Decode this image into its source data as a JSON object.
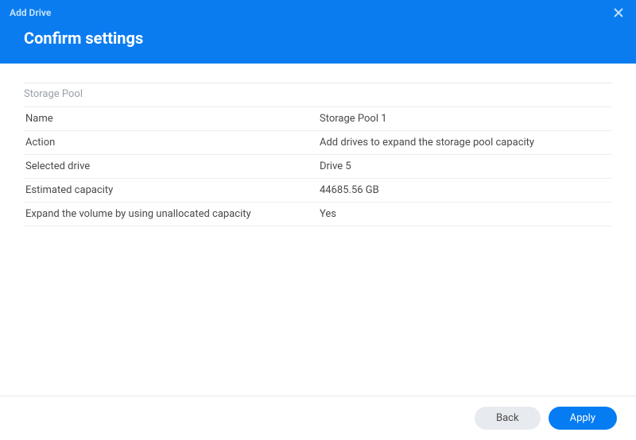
{
  "window": {
    "title": "Add Drive"
  },
  "header": {
    "page_title": "Confirm settings"
  },
  "section": {
    "title": "Storage Pool"
  },
  "details": {
    "rows": [
      {
        "label": "Name",
        "value": "Storage Pool 1"
      },
      {
        "label": "Action",
        "value": "Add drives to expand the storage pool capacity"
      },
      {
        "label": "Selected drive",
        "value": "Drive 5"
      },
      {
        "label": "Estimated capacity",
        "value": "44685.56 GB"
      },
      {
        "label": "Expand the volume by using unallocated capacity",
        "value": "Yes"
      }
    ]
  },
  "footer": {
    "back_label": "Back",
    "apply_label": "Apply"
  }
}
